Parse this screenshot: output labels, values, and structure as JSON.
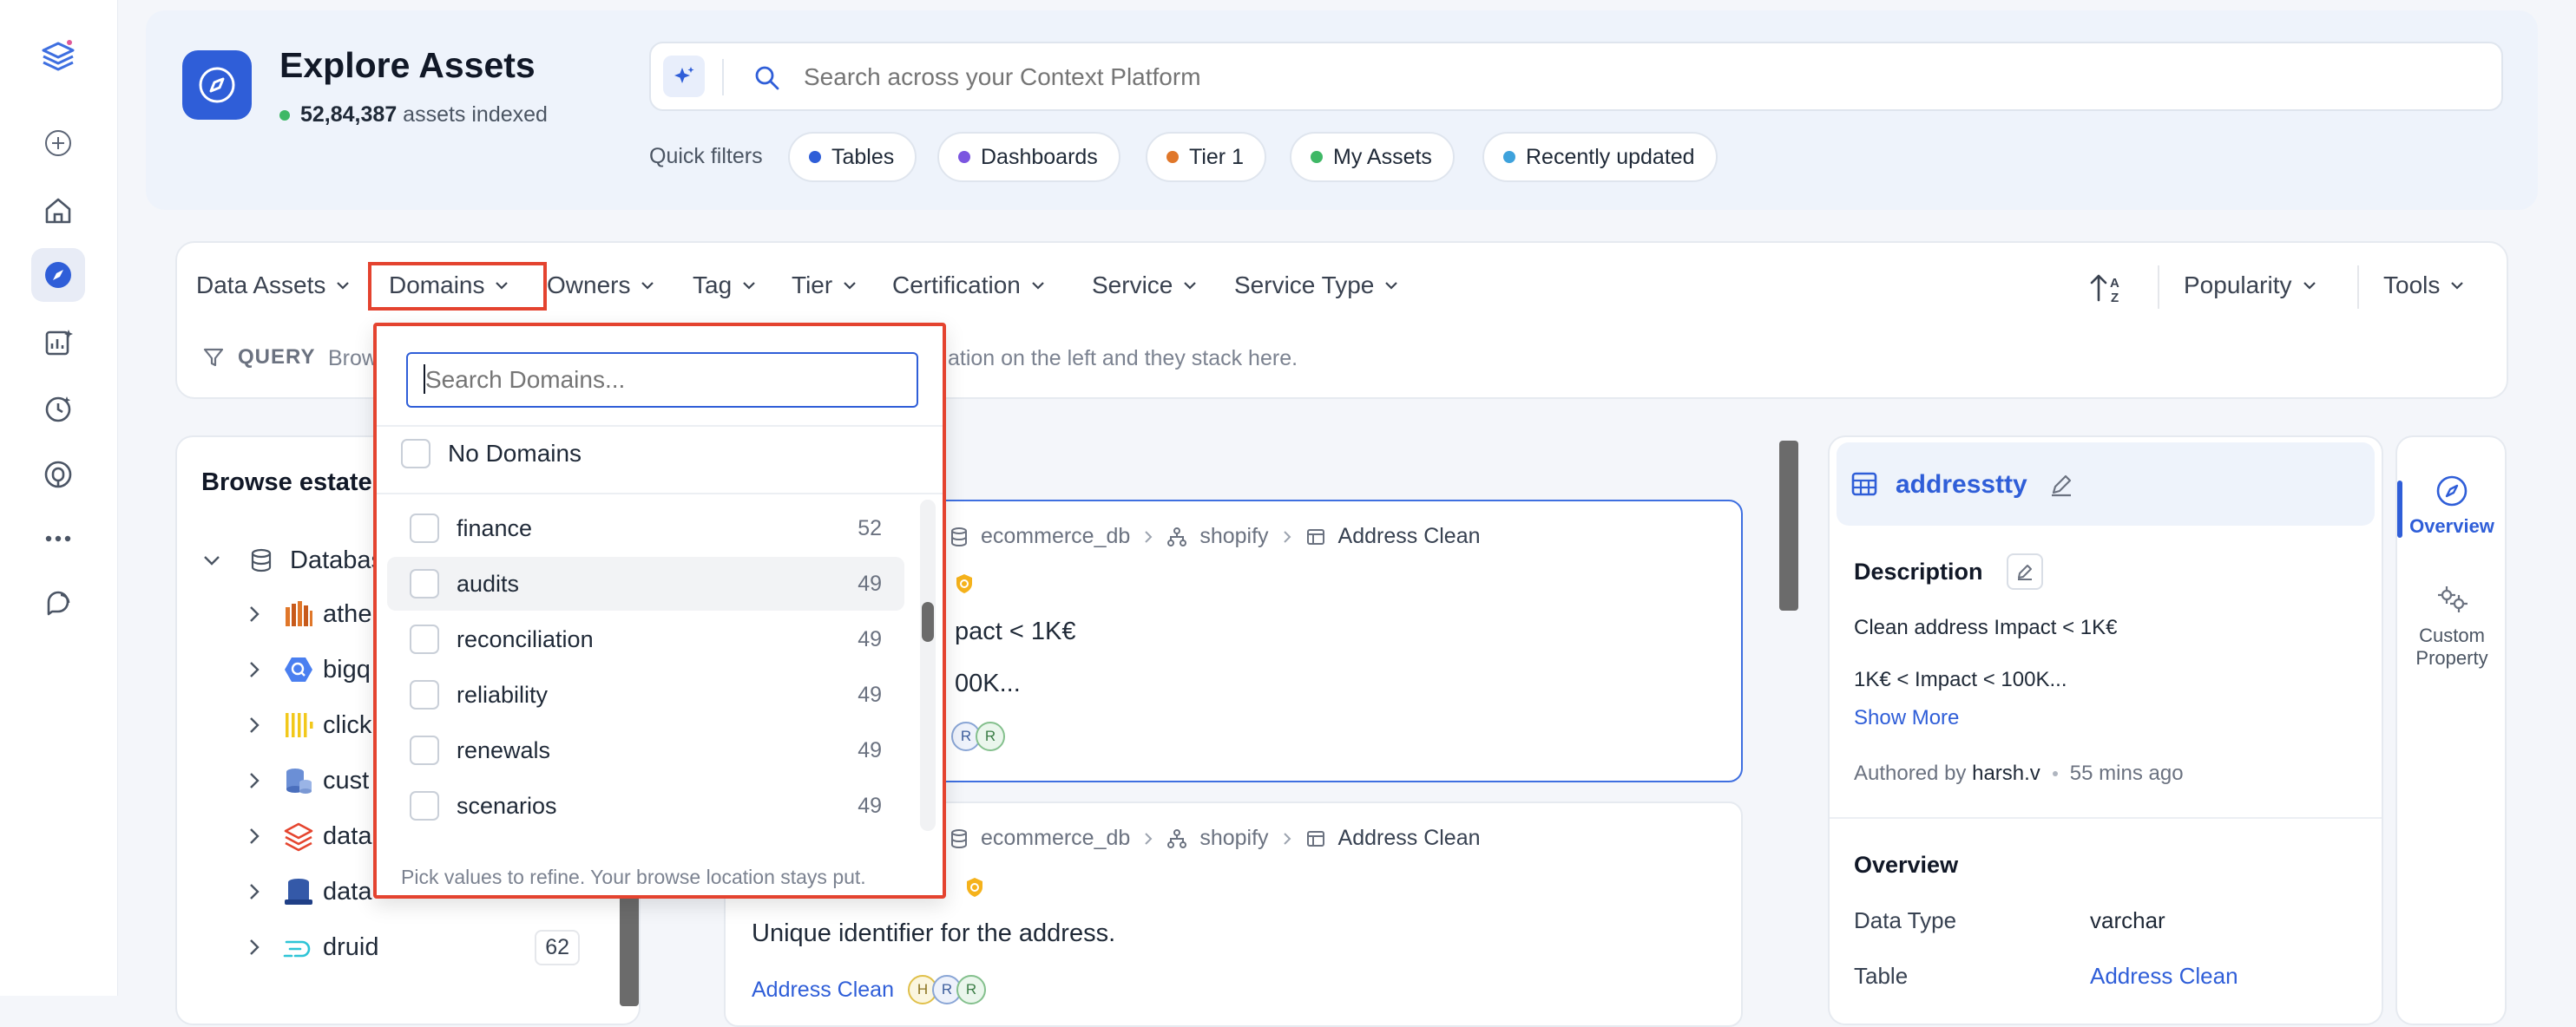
{
  "header": {
    "title": "Explore Assets",
    "indexed_count": "52,84,387",
    "indexed_suffix": "assets indexed",
    "search_placeholder": "Search across your Context Platform",
    "quick_filters_label": "Quick filters",
    "quick_filters": [
      {
        "label": "Tables",
        "color": "#2f5ed8"
      },
      {
        "label": "Dashboards",
        "color": "#7b55e0"
      },
      {
        "label": "Tier 1",
        "color": "#e0772a"
      },
      {
        "label": "My Assets",
        "color": "#3fb866"
      },
      {
        "label": "Recently updated",
        "color": "#3ea2dc"
      }
    ]
  },
  "filters": {
    "items": [
      "Data Assets",
      "Domains",
      "Owners",
      "Tag",
      "Tier",
      "Certification",
      "Service",
      "Service Type"
    ],
    "sort_icon": "sort-a-z-icon",
    "popularity_label": "Popularity",
    "tools_label": "Tools",
    "query_label": "QUERY",
    "query_hint_start": "Brows",
    "query_hint_end": "ation on the left and they stack here."
  },
  "domains_dropdown": {
    "search_placeholder": "Search Domains...",
    "no_domains_label": "No Domains",
    "options": [
      {
        "label": "finance",
        "count": "52"
      },
      {
        "label": "audits",
        "count": "49"
      },
      {
        "label": "reconciliation",
        "count": "49"
      },
      {
        "label": "reliability",
        "count": "49"
      },
      {
        "label": "renewals",
        "count": "49"
      },
      {
        "label": "scenarios",
        "count": "49"
      }
    ],
    "footer": "Pick values to refine. Your browse location stays put."
  },
  "browse": {
    "title": "Browse estate",
    "root_label": "Databas",
    "items": [
      {
        "label": "athe",
        "icon": "athena-icon"
      },
      {
        "label": "bigq",
        "icon": "bigquery-icon"
      },
      {
        "label": "click",
        "icon": "clickhouse-icon"
      },
      {
        "label": "cust",
        "icon": "custom-database-icon"
      },
      {
        "label": "data",
        "icon": "databricks-icon"
      },
      {
        "label": "data",
        "icon": "datalake-icon"
      },
      {
        "label": "druid",
        "icon": "druid-icon",
        "count": "62"
      }
    ]
  },
  "results": [
    {
      "crumbs": [
        "ecommerce_db",
        "shopify",
        "Address Clean"
      ],
      "line1": "pact < 1K€",
      "line2": "00K...",
      "avatars": [
        "R",
        "R"
      ]
    },
    {
      "crumbs": [
        "ecommerce_db",
        "shopify",
        "Address Clean"
      ],
      "line1": "Unique identifier for the address.",
      "link": "Address Clean",
      "avatars": [
        "H",
        "R",
        "R"
      ]
    }
  ],
  "detail": {
    "name": "addresstty",
    "description_label": "Description",
    "desc_line1": "Clean address Impact < 1K€",
    "desc_line2": "1K€ < Impact < 100K...",
    "show_more": "Show More",
    "authored_by_label": "Authored by",
    "author": "harsh.v",
    "time_ago": "55 mins ago",
    "overview_label": "Overview",
    "data_type_label": "Data Type",
    "data_type_value": "varchar",
    "table_label": "Table",
    "table_value": "Address Clean"
  },
  "side_tabs": {
    "overview": "Overview",
    "custom_property_line1": "Custom",
    "custom_property_line2": "Property"
  },
  "colors": {
    "accent": "#2f5ed8",
    "highlight_border": "#e4432f",
    "indexed_dot": "#3fb866"
  }
}
